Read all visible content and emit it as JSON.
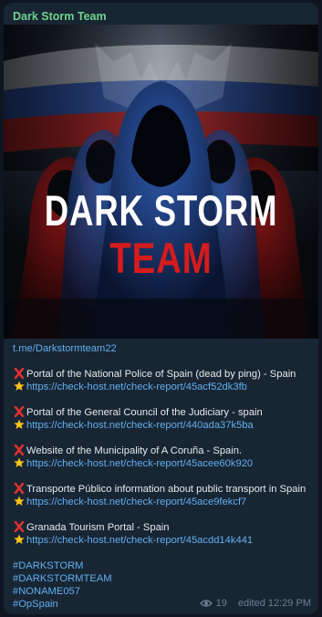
{
  "message": {
    "sender": "Dark Storm Team",
    "image": {
      "title_line1": "DARK STORM",
      "title_line2": "TEAM"
    },
    "channel_link": "t.me/Darkstormteam22",
    "entries": [
      {
        "icon": "red-x-icon",
        "title": "Portal of the National Police of Spain (dead by ping) - Spain",
        "star_icon": "star-icon",
        "link": "https://check-host.net/check-report/45acf52dk3fb"
      },
      {
        "icon": "red-x-icon",
        "title": "Portal of the General Council of the Judiciary - spain",
        "star_icon": "star-icon",
        "link": "https://check-host.net/check-report/440ada37k5ba"
      },
      {
        "icon": "red-x-icon",
        "title": "Website of the Municipality of A Coruña - Spain.",
        "star_icon": "star-icon",
        "link": "https://check-host.net/check-report/45acee60k920"
      },
      {
        "icon": "red-x-icon",
        "title": "Transporte Público information about public transport in Spain",
        "star_icon": "star-icon",
        "link": "https://check-host.net/check-report/45ace9fekcf7"
      },
      {
        "icon": "red-x-icon",
        "title": "Granada Tourism Portal - Spain",
        "star_icon": "star-icon",
        "link": "https://check-host.net/check-report/45acdd14k441"
      }
    ],
    "hashtags": [
      "#DARKSTORM",
      "#DARKSTORMTEAM",
      "#NONAME057",
      "#OpSpain"
    ],
    "views": "19",
    "edited_time": "edited 12:29 PM",
    "colors": {
      "sender": "#6fd28d",
      "link": "#62aff0",
      "bubble": "#182533",
      "background": "#0e1621"
    }
  }
}
